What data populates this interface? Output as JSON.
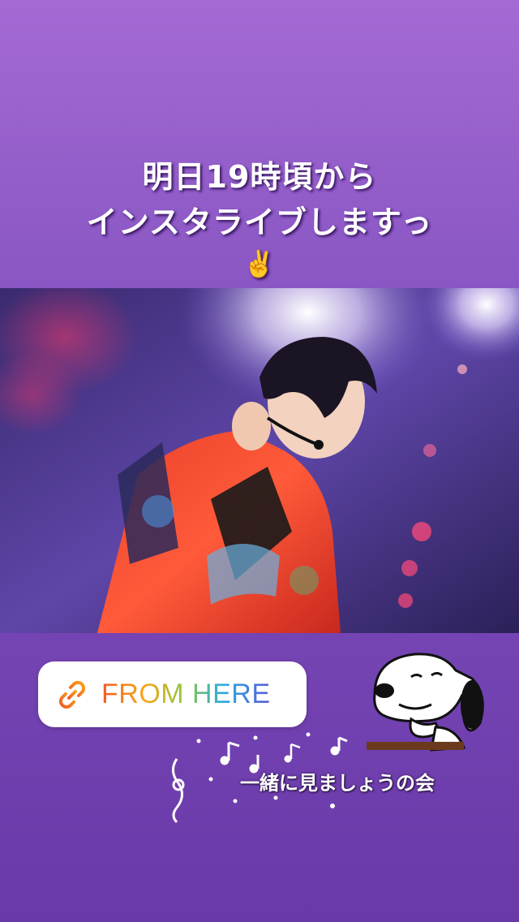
{
  "story": {
    "headline_line1": "明日19時頃から",
    "headline_line2": "インスタライブしますっ",
    "headline_emoji": "✌️",
    "link_sticker": {
      "icon": "link-icon",
      "label": "FROM HERE"
    },
    "caption": "一緒に見ましょうの会",
    "stickers": [
      "snoopy-sticker",
      "music-notes-sticker"
    ]
  },
  "colors": {
    "background_top": "#a46ad4",
    "background_bottom": "#6a39a9",
    "headline_text": "#ffffff",
    "sticker_bg": "#ffffff"
  }
}
